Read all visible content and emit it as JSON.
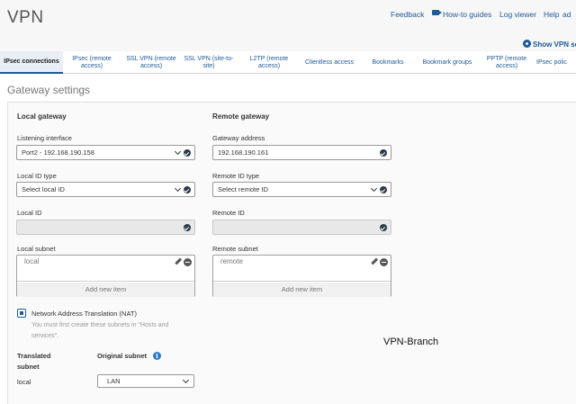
{
  "app": {
    "title": "VPN"
  },
  "header": {
    "links": [
      "Feedback",
      "How-to guides",
      "Log viewer",
      "Help",
      "ad"
    ],
    "show_vpn_settings": "Show VPN set"
  },
  "tabs": [
    {
      "label": "IPsec connections",
      "active": true
    },
    {
      "label": "IPsec (remote access)",
      "active": false
    },
    {
      "label": "SSL VPN (remote access)",
      "active": false
    },
    {
      "label": "SSL VPN (site-to-site)",
      "active": false
    },
    {
      "label": "L2TP (remote access)",
      "active": false
    },
    {
      "label": "Clientless access",
      "active": false
    },
    {
      "label": "Bookmarks",
      "active": false
    },
    {
      "label": "Bookmark groups",
      "active": false
    },
    {
      "label": "PPTP (remote access)",
      "active": false
    },
    {
      "label": "IPsec polic",
      "active": false
    }
  ],
  "section": {
    "title": "Gateway settings"
  },
  "local": {
    "title": "Local gateway",
    "listening_interface_label": "Listening interface",
    "listening_interface_value": "Port2 - 192.168.190.158",
    "local_id_type_label": "Local ID type",
    "local_id_type_value": "Select local ID",
    "local_id_label": "Local ID",
    "local_id_value": "",
    "local_subnet_label": "Local subnet",
    "local_subnet_value": "local",
    "add_new_item": "Add new item"
  },
  "remote": {
    "title": "Remote gateway",
    "gateway_address_label": "Gateway address",
    "gateway_address_value": "192.168.190.161",
    "remote_id_type_label": "Remote ID type",
    "remote_id_type_value": "Select remote ID",
    "remote_id_label": "Remote ID",
    "remote_id_value": "",
    "remote_subnet_label": "Remote subnet",
    "remote_subnet_value": "remote",
    "add_new_item": "Add new item"
  },
  "nat": {
    "checked": true,
    "label": "Network Address Translation (NAT)",
    "note": "You must first create these subnets in \"Hosts and services\"."
  },
  "translation": {
    "translated_subnet_header": "Translated subnet",
    "original_subnet_header": "Original subnet",
    "translated_value": "local",
    "original_value": "LAN"
  },
  "annotation": "VPN-Branch",
  "colors": {
    "accent": "#1f5a96",
    "info": "#2a78c8"
  },
  "icons": [
    "video-camera-icon",
    "gear-icon",
    "chevron-down-icon",
    "check-circle-icon",
    "pencil-icon",
    "remove-icon",
    "info-icon",
    "checkbox-icon"
  ]
}
